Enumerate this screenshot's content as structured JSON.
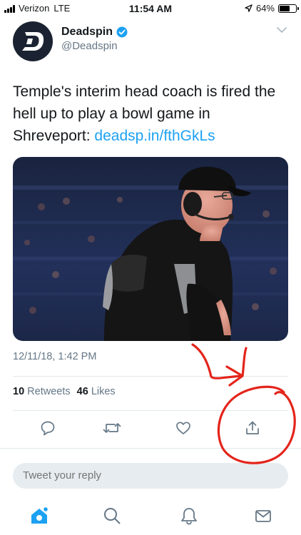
{
  "status_bar": {
    "carrier": "Verizon",
    "network": "LTE",
    "time": "11:54 AM",
    "battery": "64%",
    "battery_level": 0.64
  },
  "tweet": {
    "author_name": "Deadspin",
    "handle": "@Deadspin",
    "text": "Temple's interim head coach is fired the hell up to play a bowl game in Shreveport: ",
    "link": "deadsp.in/fthGkLs",
    "timestamp": "12/11/18, 1:42 PM"
  },
  "stats": {
    "retweets_count": "10",
    "retweets_label": "Retweets",
    "likes_count": "46",
    "likes_label": "Likes"
  },
  "reply": {
    "placeholder": "Tweet your reply"
  },
  "icons": {
    "status": [
      "signal-icon",
      "location-arrow-icon",
      "battery-icon"
    ],
    "header": [
      "deadspin-logo",
      "verified-badge-icon",
      "chevron-down-icon"
    ],
    "actions": [
      "reply-icon",
      "retweet-icon",
      "like-icon",
      "share-icon"
    ],
    "tabs": [
      "home-icon",
      "search-icon",
      "notifications-icon",
      "messages-icon"
    ]
  },
  "colors": {
    "link": "#1da1f2",
    "secondary_text": "#657786",
    "annotation": "#e4241b"
  }
}
